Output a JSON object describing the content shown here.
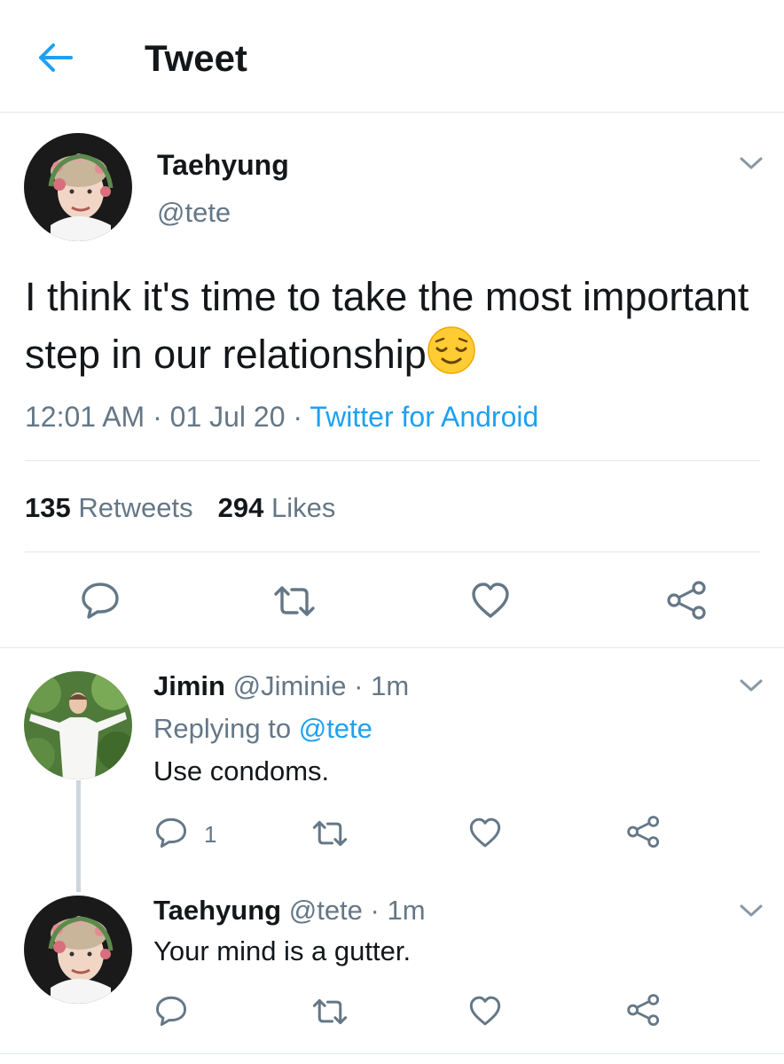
{
  "header": {
    "title": "Tweet",
    "back_icon": "arrow-left-icon",
    "accent": "#1da1f2"
  },
  "tweet": {
    "author_name": "Taehyung",
    "author_handle": "@tete",
    "text": "I think it's time to take the most important step in our relationship",
    "emoji": "relieved-face-emoji",
    "time": "12:01 AM",
    "date": "01 Jul 20",
    "source": "Twitter for Android",
    "sep": "·",
    "retweets_count": "135",
    "retweets_label": "Retweets",
    "likes_count": "294",
    "likes_label": "Likes"
  },
  "replies": [
    {
      "name": "Jimin",
      "handle": "@Jiminie",
      "time": "1m",
      "replying_label": "Replying to",
      "replying_to": "@tete",
      "text": "Use condoms.",
      "reply_count": "1"
    },
    {
      "name": "Taehyung",
      "handle": "@tete",
      "time": "1m",
      "text": "Your mind is a gutter."
    }
  ],
  "colors": {
    "text": "#14171a",
    "secondary": "#657786",
    "link": "#1da1f2",
    "divider": "#e1e8ed"
  }
}
